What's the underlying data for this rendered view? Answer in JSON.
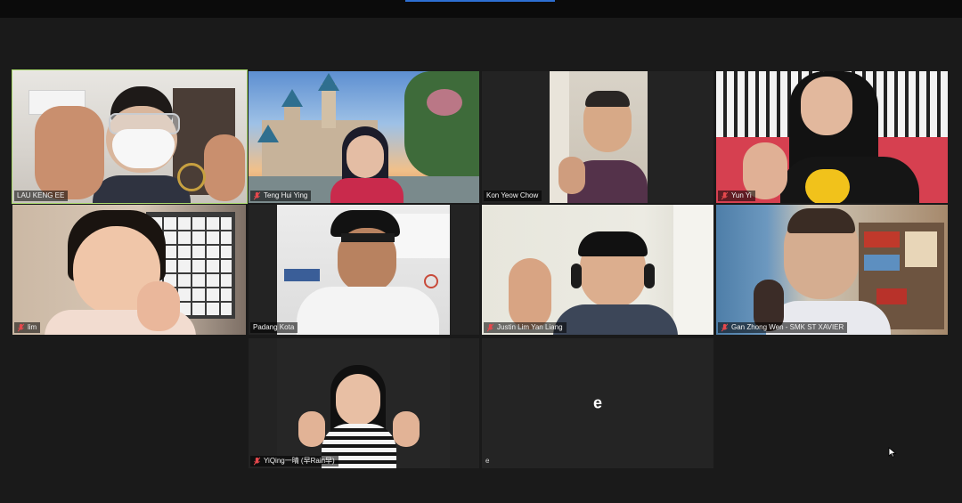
{
  "participants": [
    {
      "name": "LAU KENG EE",
      "muted": true,
      "active_speaker": true
    },
    {
      "name": "Teng Hui Ying",
      "muted": true
    },
    {
      "name": "Kon Yeow Chow",
      "muted": false
    },
    {
      "name": "Yun Yi",
      "muted": true
    },
    {
      "name": "lim",
      "muted": true
    },
    {
      "name": "Padang Kota",
      "muted": false
    },
    {
      "name": "Justin Lim Yan Liang",
      "muted": true
    },
    {
      "name": "Gan Zhong Wen - SMK ST XAVIER",
      "muted": true
    },
    {
      "name": "YiQing一晴 (早Rain早)",
      "muted": true
    },
    {
      "name": "e",
      "initial": "e",
      "muted": false,
      "video_off": true
    }
  ],
  "colors": {
    "background": "#1a1a1a",
    "active_speaker_border": "#a8d86a",
    "muted_icon": "#e5484d"
  }
}
